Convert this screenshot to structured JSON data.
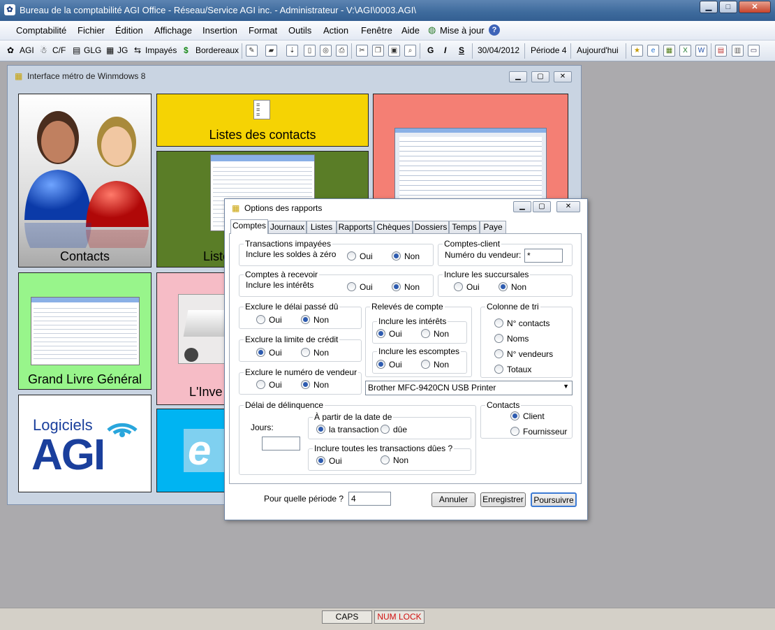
{
  "window": {
    "title": "Bureau de la comptabilité AGI Office - Réseau/Service AGI inc. - Administrateur - V:\\AGI\\0003.AGI\\"
  },
  "menu": [
    "Comptabilité",
    "Fichier",
    "Édition",
    "Affichage",
    "Insertion",
    "Format",
    "Outils",
    "Action",
    "Fenêtre",
    "Aide",
    "Mise à jour"
  ],
  "toolbar": {
    "agi": "AGI",
    "cf": "C/F",
    "glg": "GLG",
    "jg": "JG",
    "impayes": "Impayés",
    "bordereaux": "Bordereaux",
    "bold": "G",
    "italic": "I",
    "underline": "S",
    "date": "30/04/2012",
    "periode": "Période 4",
    "aujourdhui": "Aujourd'hui"
  },
  "metro": {
    "title": "Interface métro de Winmdows 8",
    "tiles": {
      "contacts": "Contacts",
      "listes": "Listes des contacts",
      "liste2": "Liste",
      "gl": "Grand Livre Général",
      "inventaire": "L'Inve",
      "logo_top": "Logiciels",
      "logo_bottom": "AGI"
    }
  },
  "dialog": {
    "title": "Options des rapports",
    "tabs": [
      "Comptes",
      "Journaux",
      "Listes",
      "Rapports",
      "Chèques",
      "Dossiers",
      "Temps",
      "Paye"
    ],
    "transactions_impayees": {
      "title": "Transactions impayées",
      "label": "Inclure les soldes à zéro"
    },
    "comptes_client": {
      "title": "Comptes-client",
      "label": "Numéro du vendeur:",
      "value": "*"
    },
    "comptes_recevoir": {
      "title": "Comptes à recevoir",
      "label": "Inclure les intérêts"
    },
    "succursales": {
      "title": "Inclure les succursales"
    },
    "delai": {
      "title": "Exclure le délai passé dû"
    },
    "limite": {
      "title": "Exclure la limite de crédit"
    },
    "vendeur": {
      "title": "Exclure le numéro de vendeur"
    },
    "releves": {
      "title": "Relevés de compte",
      "interets": "Inclure les intérêts",
      "escomptes": "Inclure les escomptes"
    },
    "colonne_tri": {
      "title": "Colonne de tri",
      "options": [
        "N° contacts",
        "Noms",
        "N° vendeurs",
        "Totaux"
      ]
    },
    "printer": "Brother MFC-9420CN USB Printer",
    "delinquence": {
      "title": "Délai de délinquence",
      "jours": "Jours:",
      "a_partir": "À partir de la date de",
      "transaction": "la transaction",
      "due": "dûe",
      "inclure_dues": "Inclure toutes les transactions dûes ?"
    },
    "contacts": {
      "title": "Contacts",
      "client": "Client",
      "fournisseur": "Fournisseur"
    },
    "oui": "Oui",
    "non": "Non",
    "periode_label": "Pour quelle période ?",
    "periode_value": "4",
    "annuler": "Annuler",
    "enregistrer": "Enregistrer",
    "poursuivre": "Poursuivre"
  },
  "status": {
    "caps": "CAPS",
    "numlock": "NUM LOCK"
  },
  "colors": {
    "yellow": "#f5d304",
    "green": "#5a7d27",
    "salmon": "#f47f74",
    "lightgreen": "#98f58b",
    "pink": "#f6bcc6",
    "cyan": "#00b4f2"
  }
}
